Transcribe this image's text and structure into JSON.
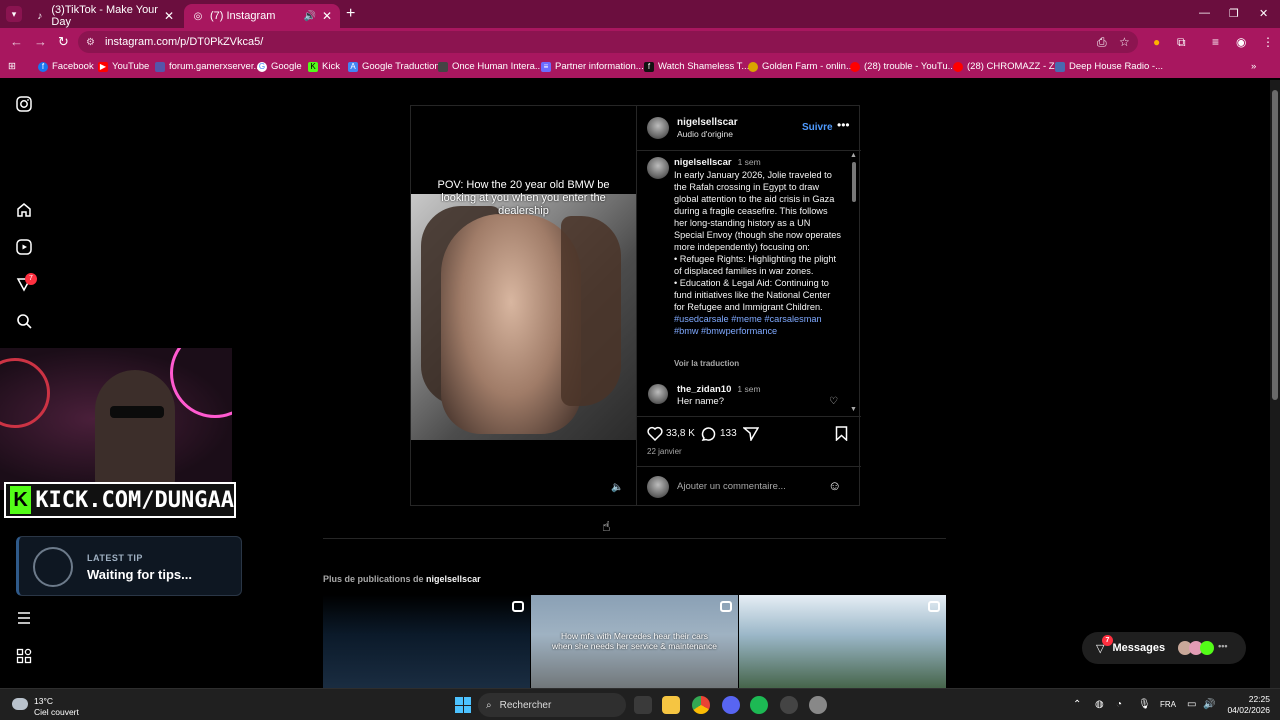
{
  "browser": {
    "tabs": [
      {
        "title": "(3)TikTok - Make Your Day"
      },
      {
        "title": "(7) Instagram"
      }
    ],
    "url": "instagram.com/p/DT0PkZVkca5/",
    "bookmarks": [
      {
        "label": "Facebook",
        "color": "#1877f2"
      },
      {
        "label": "YouTube",
        "color": "#ff0000"
      },
      {
        "label": "forum.gamerxserver...",
        "color": "#5555aa"
      },
      {
        "label": "Google",
        "color": "#ffffff"
      },
      {
        "label": "Kick",
        "color": "#53fc18"
      },
      {
        "label": "Google Traduction",
        "color": "#4285f4"
      },
      {
        "label": "Once Human Intera...",
        "color": "#444444"
      },
      {
        "label": "Partner information...",
        "color": "#6c6cff"
      },
      {
        "label": "Watch Shameless T...",
        "color": "#111111"
      },
      {
        "label": "Golden Farm - onlin...",
        "color": "#d9a400"
      },
      {
        "label": "(28) trouble - YouTu...",
        "color": "#ff0000"
      },
      {
        "label": "(28) CHROMAZZ - Z...",
        "color": "#ff0000"
      },
      {
        "label": "Deep House Radio -...",
        "color": "#4a6ab0"
      }
    ]
  },
  "ig_nav": {
    "notifications_badge": "7"
  },
  "stream_overlay": {
    "kick_handle": "KICK.COM/DUNGAA",
    "tip_label": "LATEST TIP",
    "tip_text": "Waiting for tips..."
  },
  "post": {
    "video_caption": "POV: How the 20 year old BMW be looking at you when you enter the dealership",
    "author": "nigelsellscar",
    "audio": "Audio d'origine",
    "follow_label": "Suivre",
    "caption_time": "1 sem",
    "caption": "In early January 2026, Jolie traveled to the Rafah crossing in Egypt to draw global attention to the aid crisis in Gaza during a fragile ceasefire. This follows her long-standing history as a UN Special Envoy (though she now operates more independently) focusing on:\n• Refugee Rights: Highlighting the plight of displaced families in war zones.\n• Education & Legal Aid: Continuing to fund initiatives like the National Center for Refugee and Immigrant Children.",
    "hashtags": "#usedcarsale #meme #carsalesman #bmw #bmwperformance",
    "see_translation": "Voir la traduction",
    "comments": [
      {
        "user": "the_zidan10",
        "time": "1 sem",
        "text": "Her name?"
      }
    ],
    "likes": "33,8 K",
    "comment_count": "133",
    "date": "22 janvier",
    "comment_placeholder": "Ajouter un commentaire..."
  },
  "more_posts": {
    "label_prefix": "Plus de publications de",
    "author": "nigelsellscar",
    "thumbs": [
      {
        "caption": ""
      },
      {
        "caption": "How mfs with Mercedes hear their cars when she needs her service & maintenance"
      },
      {
        "caption": ""
      }
    ]
  },
  "messages": {
    "label": "Messages",
    "badge": "7"
  },
  "taskbar": {
    "temperature": "13°C",
    "weather": "Ciel couvert",
    "search_placeholder": "Rechercher",
    "language": "FRA",
    "time": "22:25",
    "date": "04/02/2026"
  }
}
